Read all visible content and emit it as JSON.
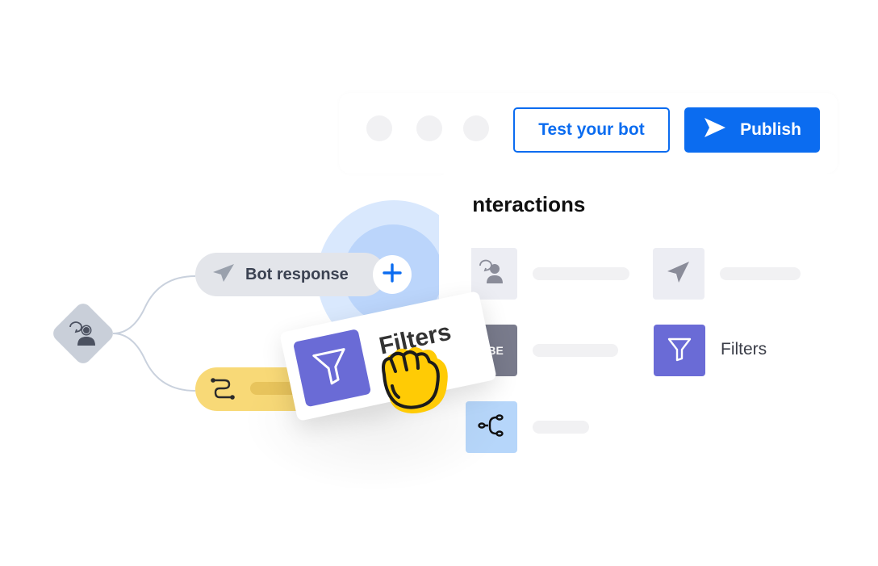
{
  "toolbar": {
    "window_dots": 3,
    "test_button": "Test your bot",
    "publish_button": "Publish",
    "publish_icon": "send-icon",
    "accent_color": "#0b6cf0"
  },
  "interactions": {
    "title": "Interactions",
    "items": [
      {
        "icon": "user-chat-icon",
        "label": "",
        "placeholder": true
      },
      {
        "icon": "send-icon",
        "label": "",
        "placeholder": true
      },
      {
        "icon": "subscribe-icon",
        "icon_text": "UBE",
        "label": "",
        "placeholder": true
      },
      {
        "icon": "filter-icon",
        "label": "Filters",
        "placeholder": false
      },
      {
        "icon": "split-icon",
        "label": "",
        "placeholder": true
      }
    ]
  },
  "flow": {
    "start_node_icon": "user-chat-icon",
    "bot_response_label": "Bot response",
    "bot_response_icon": "send-icon",
    "add_button_icon": "plus-icon",
    "route_node_icon": "route-icon"
  },
  "drag": {
    "card_label": "Filters",
    "card_icon": "filter-icon",
    "cursor_icon": "grab-hand-icon",
    "filter_color": "#6a6bd6"
  }
}
